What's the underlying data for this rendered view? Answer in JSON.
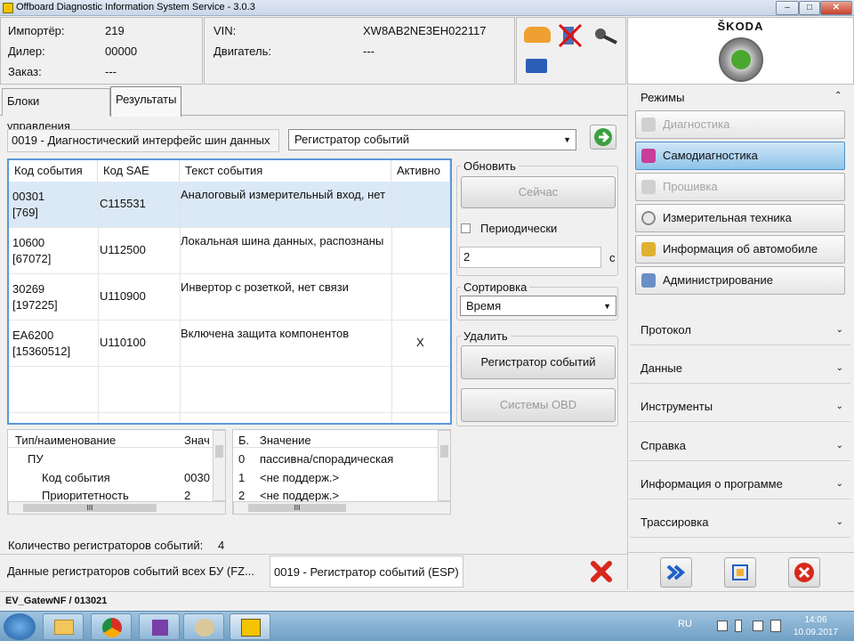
{
  "window": {
    "title": "Offboard Diagnostic Information System Service - 3.0.3"
  },
  "info": {
    "importer_label": "Импортёр:",
    "importer_value": "219",
    "dealer_label": "Дилер:",
    "dealer_value": "00000",
    "order_label": "Заказ:",
    "order_value": "---",
    "vin_label": "VIN:",
    "vin_value": "XW8AB2NE3EH022117",
    "engine_label": "Двигатель:",
    "engine_value": "---"
  },
  "brand": {
    "name": "ŠKODA"
  },
  "tabs": [
    "Блоки управления",
    "Результаты"
  ],
  "ecu_field": "0019 - Диагностический интерфейс шин данных",
  "view_select": "Регистратор событий",
  "events": {
    "headers": [
      "Код события",
      "Код SAE",
      "Текст события",
      "Активно"
    ],
    "rows": [
      {
        "code": "00301",
        "sub": "[769]",
        "sae": "C115531",
        "text": "Аналоговый измерительный вход, нет",
        "active": ""
      },
      {
        "code": "10600",
        "sub": "[67072]",
        "sae": "U112500",
        "text": "Локальная шина данных, распознаны",
        "active": ""
      },
      {
        "code": "30269",
        "sub": "[197225]",
        "sae": "U110900",
        "text": "Инвертор с розеткой, нет связи",
        "active": ""
      },
      {
        "code": "EA6200",
        "sub": "[15360512]",
        "sae": "U110100",
        "text": "Включена защита компонентов",
        "active": "X"
      }
    ]
  },
  "refresh": {
    "title": "Обновить",
    "now_button": "Сейчас",
    "periodic_label": "Периодически",
    "interval_value": "2",
    "unit": "с"
  },
  "sort": {
    "title": "Сортировка",
    "value": "Время"
  },
  "delete": {
    "title": "Удалить",
    "event_recorder_button": "Регистратор событий",
    "obd_button": "Системы OBD"
  },
  "detail_left": {
    "headers": [
      "Тип/наименование",
      "Знач"
    ],
    "rows": [
      {
        "name": "ПУ",
        "value": ""
      },
      {
        "name": "Код события",
        "value": "0030"
      },
      {
        "name": "Приоритетность",
        "value": "2"
      }
    ],
    "scroll_glyph": "III"
  },
  "detail_right": {
    "headers": [
      "Б.",
      "Значение"
    ],
    "rows": [
      {
        "n": "0",
        "v": "пассивна/спорадическая"
      },
      {
        "n": "1",
        "v": "<не поддерж.>"
      },
      {
        "n": "2",
        "v": "<не поддерж.>"
      }
    ],
    "scroll_glyph": "III"
  },
  "count": {
    "label": "Количество регистраторов событий:",
    "value": "4"
  },
  "bottom_tabs": [
    "Данные регистраторов событий всех БУ (FZ...",
    "0019 - Регистратор событий (ESP)"
  ],
  "modes": {
    "title": "Режимы",
    "items": [
      {
        "label": "Диагностика",
        "state": "disabled"
      },
      {
        "label": "Самодиагностика",
        "state": "active"
      },
      {
        "label": "Прошивка",
        "state": "disabled"
      },
      {
        "label": "Измерительная техника",
        "state": "normal"
      },
      {
        "label": "Информация об автомобиле",
        "state": "normal"
      },
      {
        "label": "Администрирование",
        "state": "normal"
      }
    ]
  },
  "sections": [
    "Протокол",
    "Данные",
    "Инструменты",
    "Справка",
    "Информация о программе",
    "Трассировка"
  ],
  "status": {
    "text": "EV_GatewNF / 013021"
  },
  "taskbar": {
    "lang": "RU",
    "time": "14:06",
    "date": "10.09.2017"
  },
  "colors": {
    "accent": "#4a90c8",
    "skoda_green": "#4ba82e",
    "error_red": "#d8281c"
  }
}
